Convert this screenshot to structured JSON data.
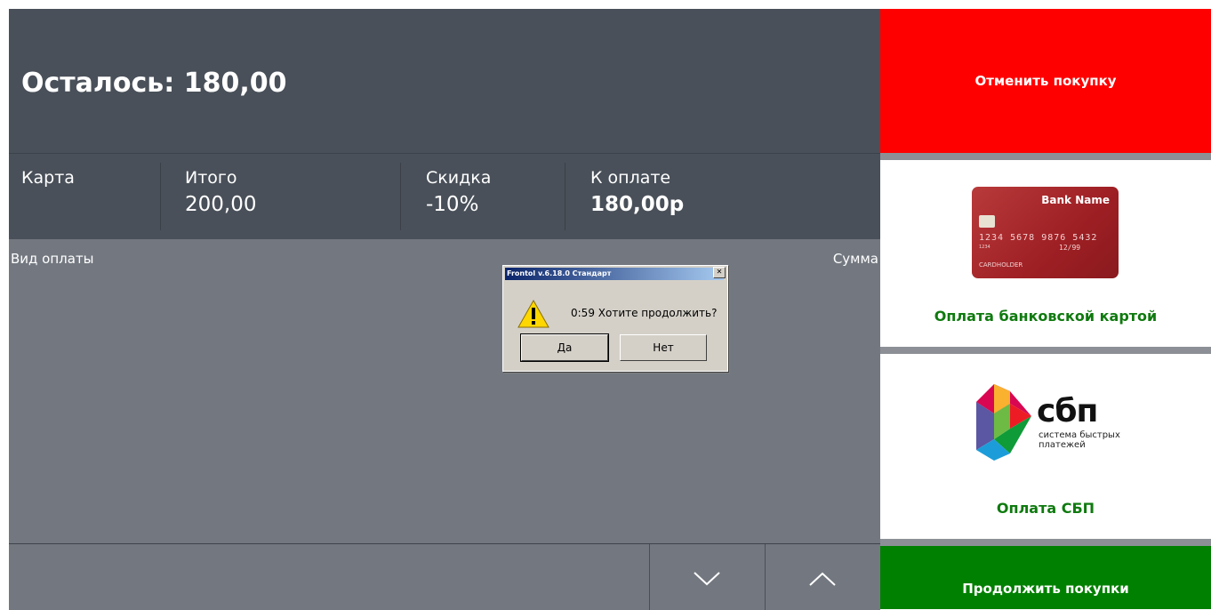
{
  "remaining": {
    "label": "Осталось: 180,00"
  },
  "summary": {
    "card_label": "Карта",
    "total_label": "Итого",
    "total_value": "200,00",
    "discount_label": "Скидка",
    "discount_value": "-10%",
    "due_label": "К оплате",
    "due_value": "180,00р"
  },
  "table": {
    "col_payment_type": "Вид оплаты",
    "col_amount": "Сумма"
  },
  "nav": {
    "down_icon": "chevron-down-icon",
    "up_icon": "chevron-up-icon"
  },
  "actions": {
    "cancel_label": "Отменить покупку",
    "card_pay_label": "Оплата банковской картой",
    "sbp_pay_label": "Оплата СБП",
    "continue_label": "Продолжить покупки"
  },
  "card_image": {
    "bank_name": "Bank Name",
    "number": "1234 5678 9876 5432",
    "small_number": "1234",
    "valid_thru": "12/99",
    "holder": "CARDHOLDER"
  },
  "sbp_logo": {
    "word": "сбп",
    "subtitle_line1": "система быстрых",
    "subtitle_line2": "платежей"
  },
  "dialog": {
    "title": "Frontol v.6.18.0 Стандарт",
    "close_label": "✕",
    "message": "0:59  Хотите продолжить?",
    "yes_label": "Да",
    "no_label": "Нет",
    "icon": "warning-icon"
  },
  "colors": {
    "header_bg": "#495059",
    "content_bg": "#737880",
    "cancel_bg": "#ff0000",
    "continue_bg": "#008000",
    "pay_label_green": "#0f7a0f"
  }
}
